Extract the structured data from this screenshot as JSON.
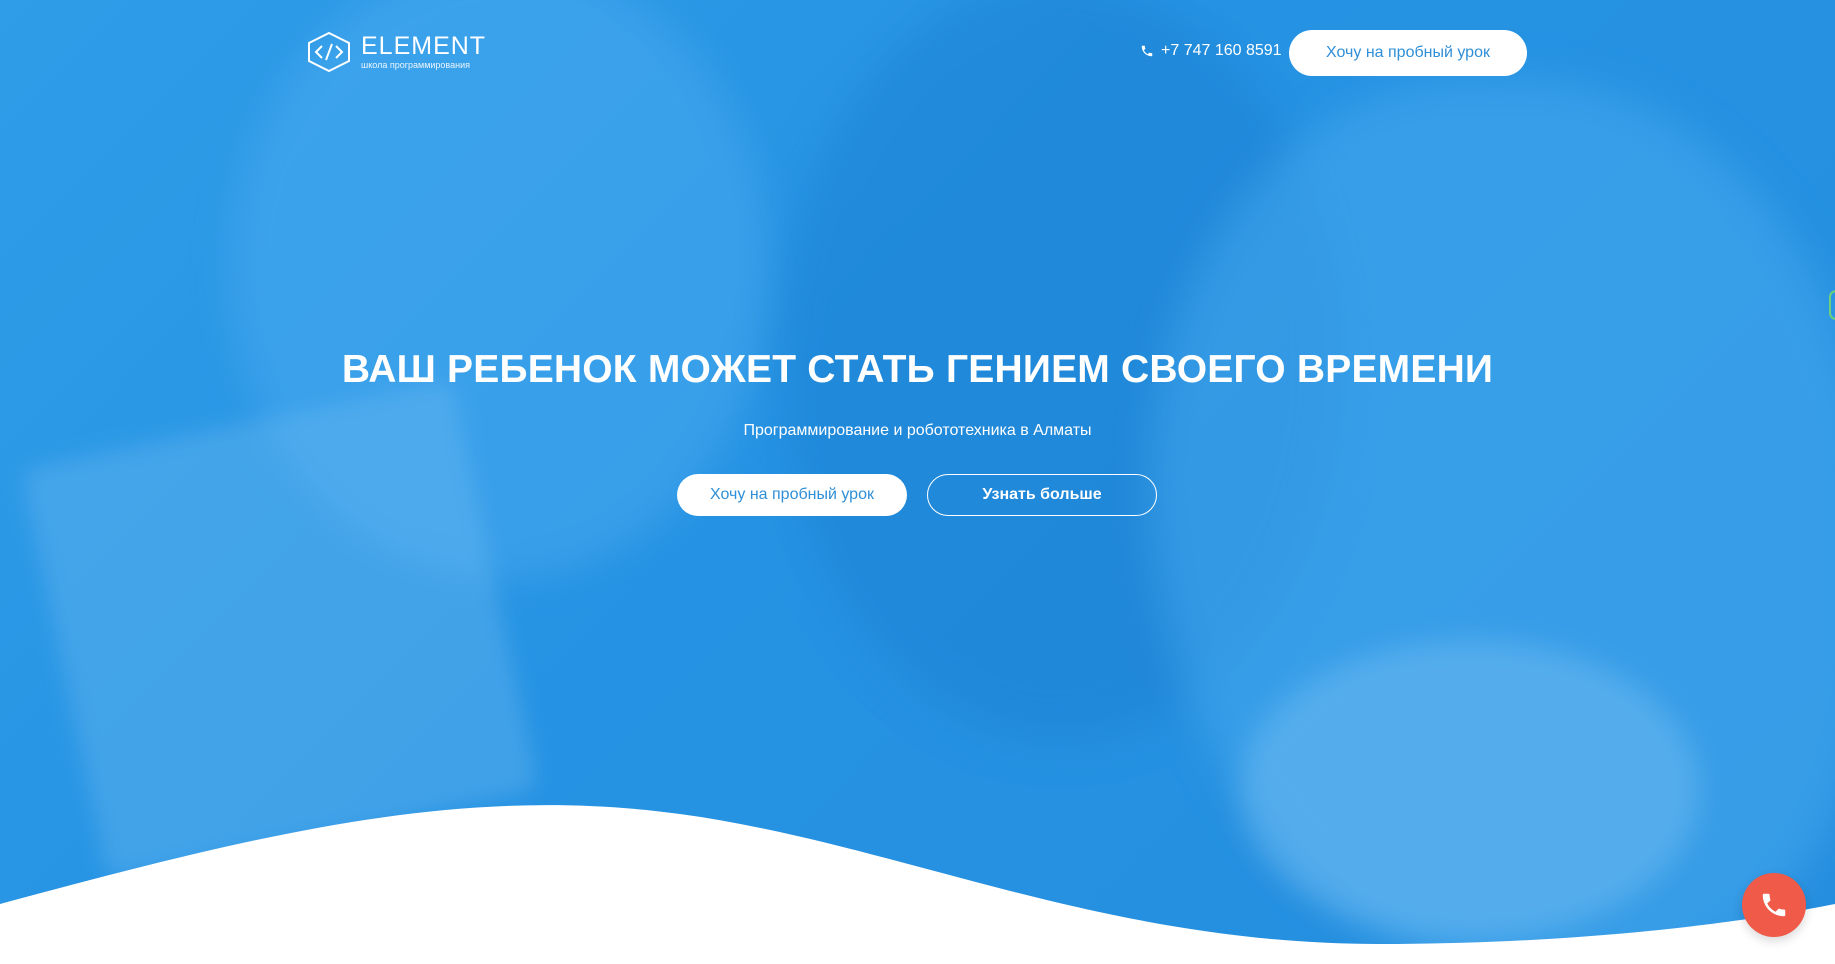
{
  "brand": {
    "name": "ELEMENT",
    "tagline": "школа программирования",
    "logo_icon": "code-cube-icon"
  },
  "header": {
    "phone": "+7 747 160 8591",
    "phone_icon": "phone-icon",
    "cta_label": "Хочу на пробный урок"
  },
  "hero": {
    "title": "ВАШ РЕБЕНОК МОЖЕТ СТАТЬ ГЕНИЕМ СВОЕГО ВРЕМЕНИ",
    "subtitle": "Программирование и робототехника в Алматы",
    "primary_button": "Хочу на пробный урок",
    "secondary_button": "Узнать больше"
  },
  "floating": {
    "call_icon": "phone-call-icon"
  },
  "colors": {
    "hero_blue": "#2b96e3",
    "button_text_blue": "#2f8fd7",
    "call_button_red": "#f05a48",
    "white": "#ffffff"
  }
}
